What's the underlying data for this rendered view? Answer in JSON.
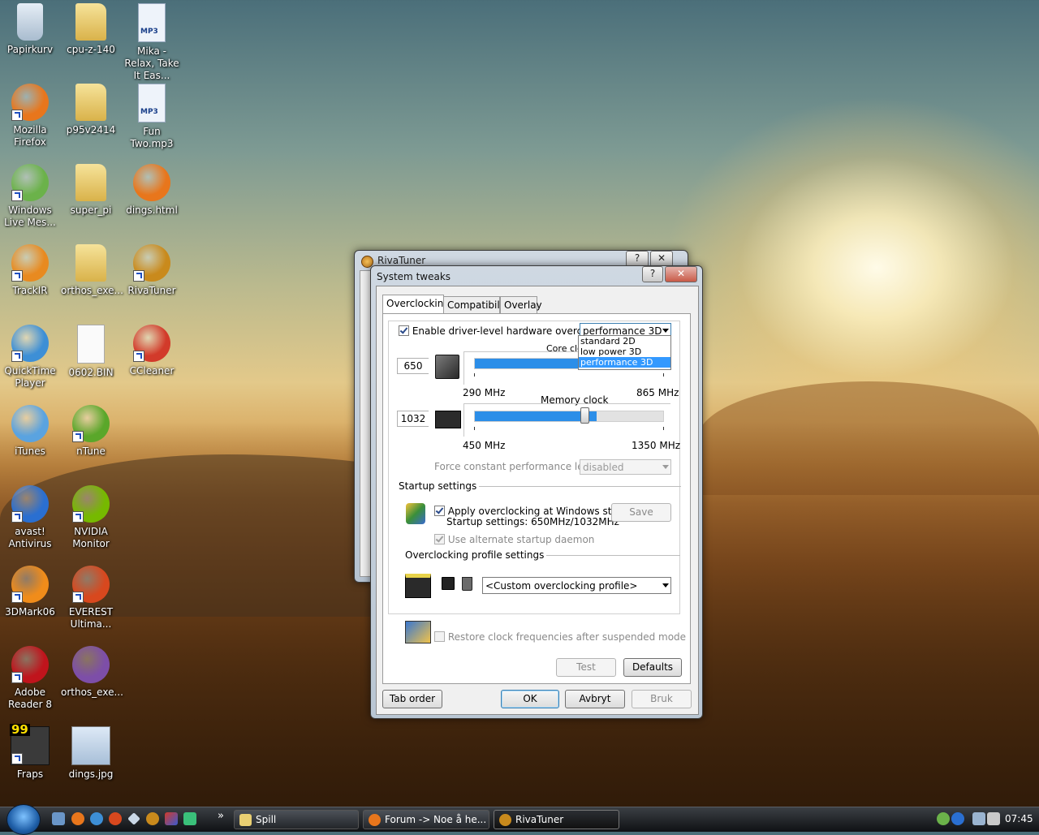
{
  "desktop": {
    "icons": [
      {
        "label": "Papirkurv",
        "color": "#c9d7e6"
      },
      {
        "label": "cpu-z-140",
        "color": "#e9cf72"
      },
      {
        "label": "Mika - Relax, Take It Eas...",
        "color": "#e7eef8"
      },
      {
        "label": "Mozilla Firefox",
        "color": "#e8761c"
      },
      {
        "label": "p95v2414",
        "color": "#e9cf72"
      },
      {
        "label": "Fun Two.mp3",
        "color": "#e7eef8"
      },
      {
        "label": "Windows Live Mes...",
        "color": "#6bb24a"
      },
      {
        "label": "super_pi",
        "color": "#e9cf72"
      },
      {
        "label": "dings.html",
        "color": "#e8761c"
      },
      {
        "label": "TrackIR",
        "color": "#e88a20"
      },
      {
        "label": "orthos_exe...",
        "color": "#e9cf72"
      },
      {
        "label": "RivaTuner",
        "color": "#c98a1c"
      },
      {
        "label": "QuickTime Player",
        "color": "#3d8fd6"
      },
      {
        "label": "0602.BIN",
        "color": "#f4f4f4"
      },
      {
        "label": "CCleaner",
        "color": "#d23a2a"
      },
      {
        "label": "iTunes",
        "color": "#5aa3e0"
      },
      {
        "label": "nTune",
        "color": "#5aa72a"
      },
      {
        "label": "avast! Antivirus",
        "color": "#2a6fd1"
      },
      {
        "label": "NVIDIA Monitor",
        "color": "#76b900"
      },
      {
        "label": "3DMark06",
        "color": "#f08c1a"
      },
      {
        "label": "EVEREST Ultima...",
        "color": "#d8481e"
      },
      {
        "label": "Adobe Reader 8",
        "color": "#c0141c"
      },
      {
        "label": "orthos_exe...",
        "color": "#7d4ea8"
      },
      {
        "label": "Fraps",
        "color": "#222222"
      },
      {
        "label": "dings.jpg",
        "color": "#c4d8ec"
      }
    ],
    "mp3_badge": "MP3",
    "fraps_badge": "99"
  },
  "back_window": {
    "title": "RivaTuner",
    "help_label": "?",
    "close_label": "✕"
  },
  "dialog": {
    "title": "System tweaks",
    "help_label": "?",
    "close_label": "✕",
    "tabs": [
      "Overclocking",
      "Compatibility",
      "Overlay"
    ],
    "enable_label": "Enable driver-level hardware overclocking",
    "enable_checked": true,
    "profile_select": {
      "value": "performance 3D",
      "options": [
        "standard 2D",
        "low power 3D",
        "performance 3D"
      ],
      "selected_index": 2
    },
    "core": {
      "label": "Core clock",
      "value": "650",
      "min": "290 MHz",
      "max": "865 MHz",
      "fraction": 0.625
    },
    "memory": {
      "label": "Memory clock",
      "value": "1032",
      "min": "450 MHz",
      "max": "1350 MHz",
      "fraction": 0.647
    },
    "force_label": "Force constant performance level",
    "force_value": "disabled",
    "startup_header": "Startup settings",
    "apply_label": "Apply overclocking at Windows startup",
    "startup_info": "Startup settings: 650MHz/1032MHz",
    "save_label": "Save",
    "daemon_label": "Use alternate startup daemon",
    "profile_header": "Overclocking profile settings",
    "custom_profile": "<Custom overclocking profile>",
    "restore_label": "Restore clock frequencies after suspended mode",
    "test_label": "Test",
    "defaults_label": "Defaults",
    "tab_order_label": "Tab order",
    "ok_label": "OK",
    "cancel_label": "Avbryt",
    "apply_btn_label": "Bruk"
  },
  "taskbar": {
    "more_label": "»",
    "tasks": [
      {
        "label": "Spill",
        "active": false
      },
      {
        "label": "Forum -> Noe å he...",
        "active": false
      },
      {
        "label": "RivaTuner",
        "active": true
      }
    ],
    "clock": "07:45"
  }
}
